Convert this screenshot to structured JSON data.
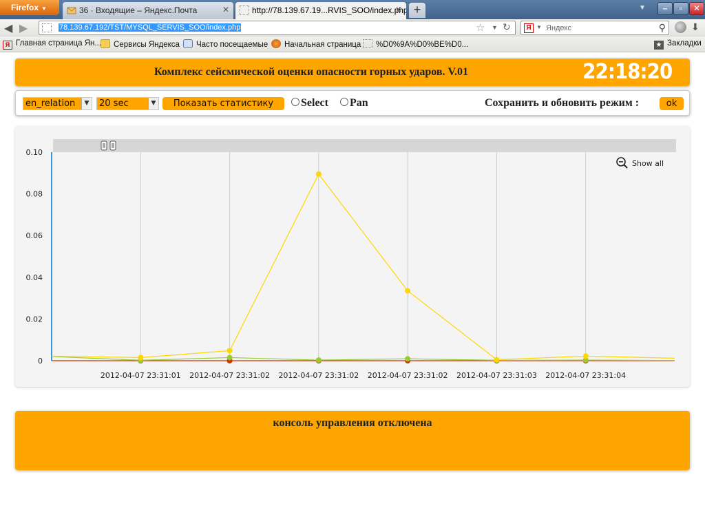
{
  "browser": {
    "menu_button": "Firefox",
    "tabs": [
      {
        "label": "36 · Входящие – Яндекс.Почта"
      },
      {
        "label": "http://78.139.67.19...RVIS_SOO/index.php"
      }
    ],
    "url": "78.139.67.192/TST/MYSQL_SERVIS_SOO/index.php",
    "search_placeholder": "Яндекс",
    "bookmarks": [
      {
        "label": "Главная страница Ян...",
        "icon": "yandex-icon"
      },
      {
        "label": "Сервисы Яндекса",
        "icon": "folder-icon"
      },
      {
        "label": "Часто посещаемые",
        "icon": "smart-folder-icon"
      },
      {
        "label": "Начальная страница",
        "icon": "firefox-icon"
      },
      {
        "label": "%D0%9A%D0%BE%D0...",
        "icon": "page-icon"
      }
    ],
    "bookmarks_menu": "Закладки"
  },
  "header": {
    "title": "Комплекс сейсмической оценки опасности горных ударов. V.01",
    "clock": "22:18:20"
  },
  "toolbar": {
    "param_select": "en_relation",
    "interval_select": "20 sec",
    "stats_button": "Показать статистику",
    "radio_select": "Select",
    "radio_pan": "Pan",
    "save_label": "Сохранить и обновить режим :",
    "ok_button": "ok"
  },
  "chart_data": {
    "type": "line",
    "show_all_label": "Show all",
    "ylim": [
      0,
      0.1
    ],
    "yticks": [
      "0",
      "0.02",
      "0.04",
      "0.06",
      "0.08",
      "0.10"
    ],
    "xtick_labels": [
      "2012-04-07 23:31:01",
      "2012-04-07 23:31:02",
      "2012-04-07 23:31:02",
      "2012-04-07 23:31:02",
      "2012-04-07 23:31:03",
      "2012-04-07 23:31:04"
    ],
    "series": [
      {
        "color": "#ffd700",
        "values": [
          0.0022,
          0.0015,
          0.0048,
          0.0895,
          0.0335,
          0.0005,
          0.0022,
          0.0012
        ]
      },
      {
        "color": "#99cc33",
        "values": [
          0.002,
          0.0002,
          0.0015,
          0.0003,
          0.0009,
          0.0002,
          0.0003,
          0.0001
        ]
      },
      {
        "color": "#cc3300",
        "values": [
          0.0,
          0.0,
          0.0,
          0.0,
          0.0,
          0.0,
          0.0,
          0.0
        ]
      }
    ],
    "colors": {
      "axis": "#3399dd",
      "grid": "#cccccc"
    }
  },
  "console": {
    "text": "консоль управления отключена"
  }
}
